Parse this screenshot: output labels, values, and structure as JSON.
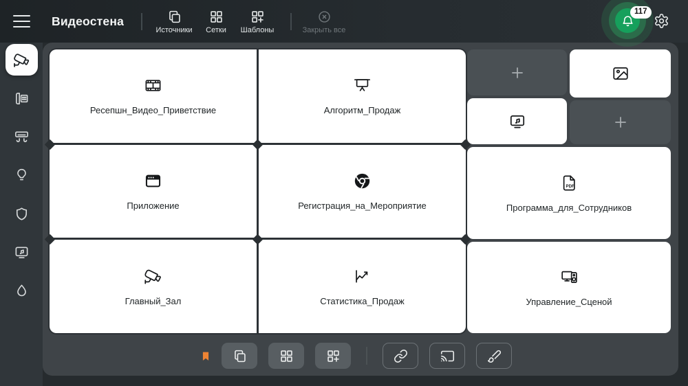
{
  "app": {
    "title": "Видеостена"
  },
  "topbar": {
    "actions": [
      {
        "id": "sources",
        "label": "Источники",
        "icon": "copy-icon",
        "enabled": true
      },
      {
        "id": "grids",
        "label": "Сетки",
        "icon": "grid-icon",
        "enabled": true
      },
      {
        "id": "templates",
        "label": "Шаблоны",
        "icon": "grid-plus-icon",
        "enabled": true
      },
      {
        "id": "close-all",
        "label": "Закрыть все",
        "icon": "close-circle-icon",
        "enabled": false
      }
    ],
    "notifications": {
      "count": "117",
      "icon": "bell-icon"
    },
    "settings_icon": "gear-icon"
  },
  "sidebar": {
    "items": [
      {
        "id": "cctv",
        "icon": "cctv-camera-icon",
        "active": true
      },
      {
        "id": "intercom",
        "icon": "intercom-phone-icon",
        "active": false
      },
      {
        "id": "climate",
        "icon": "air-conditioner-icon",
        "active": false
      },
      {
        "id": "lighting",
        "icon": "lightbulb-icon",
        "active": false
      },
      {
        "id": "security",
        "icon": "shield-icon",
        "active": false
      },
      {
        "id": "media",
        "icon": "media-screen-icon",
        "active": false
      },
      {
        "id": "water",
        "icon": "droplet-icon",
        "active": false
      }
    ]
  },
  "wall": {
    "main_tiles": [
      {
        "label": "Ресепшн_Видео_Приветствие",
        "icon": "film-icon"
      },
      {
        "label": "Алгоритм_Продаж",
        "icon": "projector-screen-icon"
      },
      {
        "label": "Приложение",
        "icon": "app-window-icon"
      },
      {
        "label": "Регистрация_на_Мероприятие",
        "icon": "chrome-icon"
      },
      {
        "label": "Главный_Зал",
        "icon": "cctv-camera-icon"
      },
      {
        "label": "Статистика_Продаж",
        "icon": "line-chart-icon"
      }
    ],
    "small_tiles": [
      {
        "type": "empty",
        "icon": "plus-icon"
      },
      {
        "type": "content",
        "icon": "image-icon"
      },
      {
        "type": "content",
        "icon": "media-screen-icon"
      },
      {
        "type": "empty",
        "icon": "plus-icon"
      }
    ],
    "side_tiles": [
      {
        "label": "Программа_для_Сотрудников",
        "icon": "pdf-file-icon"
      },
      {
        "label": "Управление_Сценой",
        "icon": "scene-control-icon"
      }
    ]
  },
  "bottom_toolbar": {
    "bookmark_icon": "bookmark-icon",
    "filled_buttons": [
      {
        "icon": "copy-icon"
      },
      {
        "icon": "grid-icon"
      },
      {
        "icon": "grid-plus-icon"
      }
    ],
    "outline_buttons": [
      {
        "icon": "link-icon"
      },
      {
        "icon": "cast-icon"
      },
      {
        "icon": "brush-icon"
      }
    ]
  },
  "colors": {
    "accent_green": "#16a05c",
    "bookmark_orange": "#ee8434",
    "panel_bg": "#3f4448",
    "topbar_bg": "#22272a",
    "tile_bg": "#ffffff",
    "dark_tile_bg": "#4a5054"
  }
}
